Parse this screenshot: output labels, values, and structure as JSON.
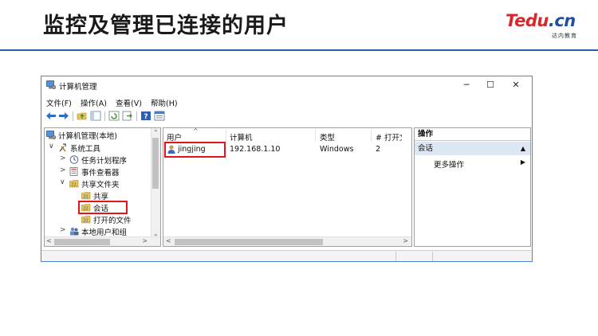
{
  "slide": {
    "title": "监控及管理已连接的用户",
    "logo_main": "Tedu.cn",
    "logo_sub": "达内教育"
  },
  "window": {
    "title": "计算机管理",
    "controls": {
      "minimize": "─",
      "maximize": "☐",
      "close": "✕"
    }
  },
  "menu": [
    "文件(F)",
    "操作(A)",
    "查看(V)",
    "帮助(H)"
  ],
  "tree": {
    "root": "计算机管理(本地)",
    "items": [
      {
        "label": "系统工具",
        "chevron": "∨"
      },
      {
        "label": "任务计划程序",
        "chevron": ">"
      },
      {
        "label": "事件查看器",
        "chevron": ">"
      },
      {
        "label": "共享文件夹",
        "chevron": "∨"
      },
      {
        "label": "共享"
      },
      {
        "label": "会话"
      },
      {
        "label": "打开的文件"
      },
      {
        "label": "本地用户和组",
        "chevron": ">"
      }
    ]
  },
  "sessions": {
    "columns": [
      "用户",
      "计算机",
      "类型",
      "# 打开文件"
    ],
    "sort_indicator": "^",
    "rows": [
      {
        "user": "jingjing",
        "computer": "192.168.1.10",
        "type": "Windows",
        "open_files": "2"
      }
    ]
  },
  "actions": {
    "header": "操作",
    "section": "会话",
    "items": [
      "更多操作"
    ]
  },
  "colors": {
    "highlight": "#e3141b",
    "title_rule": "#2a5ea8",
    "logo_red": "#d9262c",
    "logo_blue": "#1f4fa0"
  }
}
